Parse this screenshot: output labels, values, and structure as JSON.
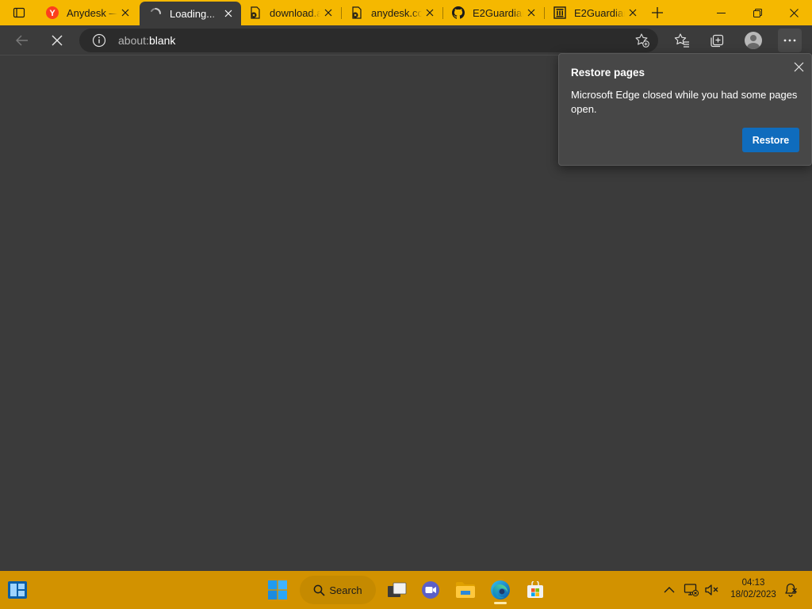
{
  "tabs": [
    {
      "title": "Anydesk —",
      "icon": "yandex-icon"
    },
    {
      "title": "Loading...",
      "icon": "loading-spinner-icon",
      "active": true
    },
    {
      "title": "download.a",
      "icon": "pdf-error-icon"
    },
    {
      "title": "anydesk.co",
      "icon": "pdf-error-icon"
    },
    {
      "title": "E2Guardian",
      "icon": "github-icon"
    },
    {
      "title": "E2Guardian",
      "icon": "institution-icon"
    }
  ],
  "address": {
    "scheme": "about:",
    "rest": "blank"
  },
  "popup": {
    "title": "Restore pages",
    "body": "Microsoft Edge closed while you had some pages open.",
    "button": "Restore"
  },
  "taskbar": {
    "search_label": "Search",
    "time": "04:13",
    "date": "18/02/2023"
  },
  "colors": {
    "tabstrip": "#f5b800",
    "page": "#3b3b3b",
    "taskbar": "#d29200",
    "accent": "#0f6cbd"
  }
}
